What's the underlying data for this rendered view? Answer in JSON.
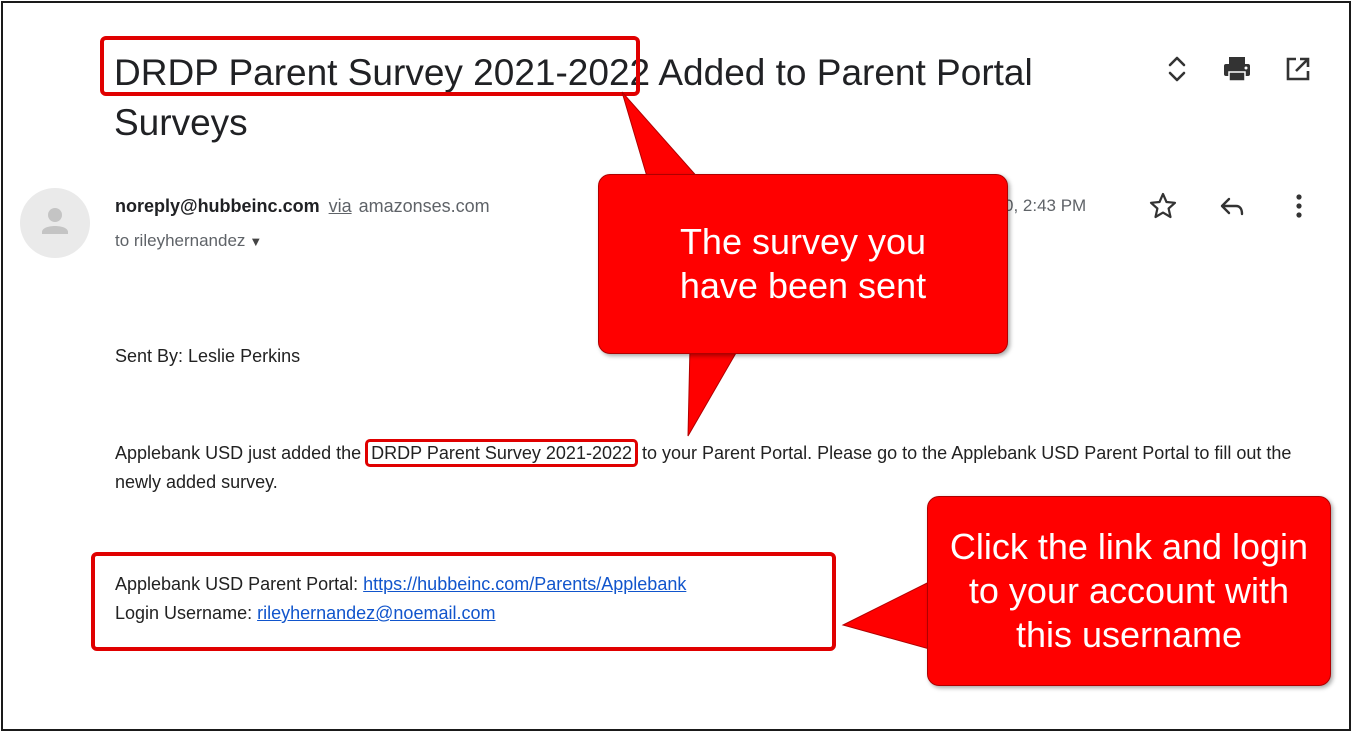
{
  "email": {
    "subject": "DRDP Parent Survey 2021-2022 Added to Parent Portal Surveys",
    "sender": {
      "email": "noreply@hubbeinc.com",
      "via_label": "via",
      "via_domain": "amazonses.com",
      "to_label": "to rileyhernandez",
      "date": "0, 2:43 PM"
    },
    "body": {
      "sent_by": "Sent By: Leslie Perkins",
      "paragraph_before": "Applebank USD just added the ",
      "survey_name": "DRDP Parent Survey 2021-2022",
      "paragraph_after": " to your Parent Portal. Please go to the Applebank USD Parent Portal to fill out the newly added survey.",
      "portal_label": "Applebank USD Parent Portal: ",
      "portal_url": "https://hubbeinc.com/Parents/Applebank",
      "username_label": "Login Username: ",
      "username": "rileyhernandez@noemail.com"
    }
  },
  "icons": {
    "top": [
      "expand-collapse-icon",
      "print-icon",
      "open-in-new-window-icon"
    ],
    "message": [
      "star-icon",
      "reply-icon",
      "more-options-icon"
    ]
  },
  "annotations": {
    "callout_survey": "The survey you have been sent",
    "callout_link": "Click the link and login to your account with this username",
    "color": "#ff0000",
    "outline_color": "#e00000"
  }
}
